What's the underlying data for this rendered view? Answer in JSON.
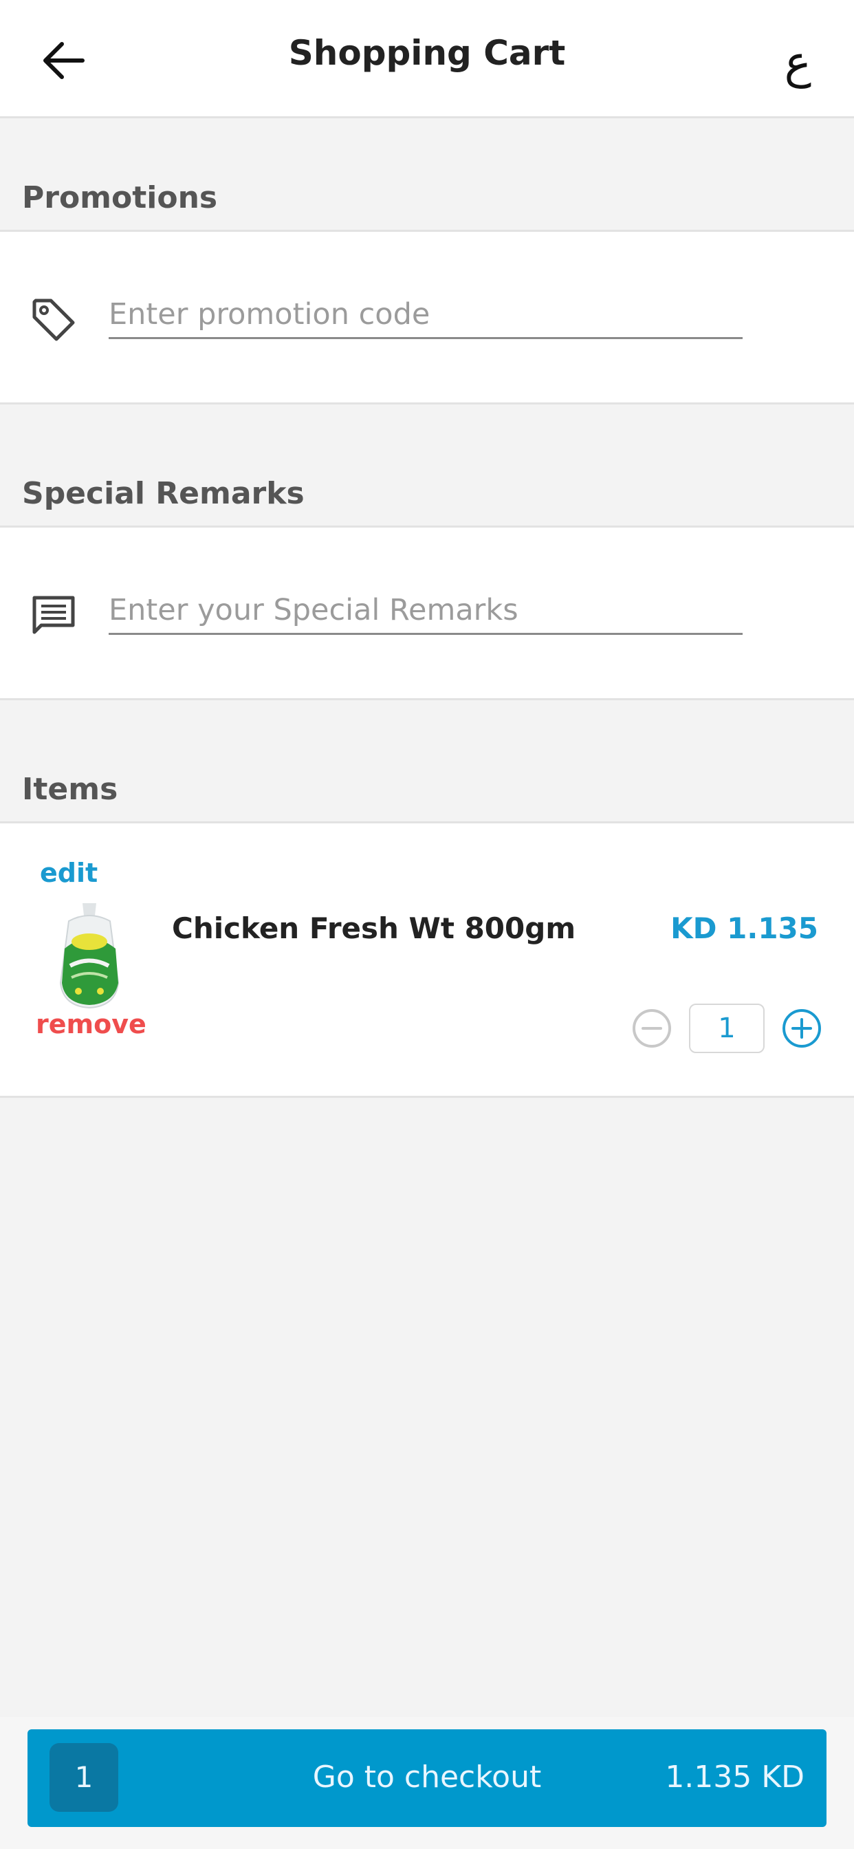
{
  "header": {
    "title": "Shopping Cart",
    "back_icon": "arrow-left-icon",
    "language_label": "ع"
  },
  "promotions": {
    "section_title": "Promotions",
    "icon": "tag-icon",
    "placeholder": "Enter promotion code",
    "value": ""
  },
  "remarks": {
    "section_title": "Special Remarks",
    "icon": "message-icon",
    "placeholder": "Enter your Special Remarks",
    "value": ""
  },
  "items": {
    "section_title": "Items",
    "list": [
      {
        "edit_label": "edit",
        "remove_label": "remove",
        "name": "Chicken Fresh Wt 800gm",
        "price": "KD 1.135",
        "quantity": "1",
        "image_icon": "product-image"
      }
    ]
  },
  "checkout": {
    "count": "1",
    "label": "Go to checkout",
    "total": "1.135 KD"
  },
  "colors": {
    "accent": "#1a9ad0",
    "checkout_bg": "#0098cc",
    "remove": "#ef4d4d"
  }
}
